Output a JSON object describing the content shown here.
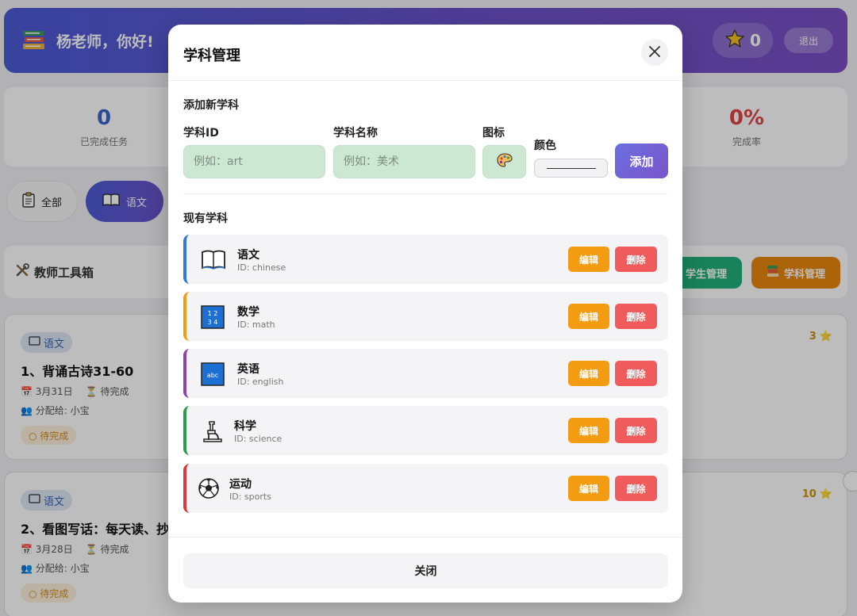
{
  "header": {
    "greeting": "杨老师，你好!",
    "stars": "0",
    "logout_label": "退出"
  },
  "stats": [
    {
      "value": "0",
      "label": "已完成任务",
      "color": "#3b63c9"
    },
    {
      "value": "0%",
      "label": "完成率",
      "color": "#e04646"
    }
  ],
  "filters": {
    "all_label": "全部",
    "chinese_label": "语文"
  },
  "toolbox": {
    "title": "教师工具箱",
    "student_btn": "学生管理",
    "subject_btn": "学科管理"
  },
  "tasks": [
    {
      "tag": "语文",
      "title": "1、背诵古诗31-60",
      "date": "3月31日",
      "state": "待完成",
      "assign": "分配给: 小宝",
      "status": "○ 待完成",
      "points": "3"
    },
    {
      "tag": "语文",
      "title": "2、看图写话：每天读、抄",
      "date": "3月28日",
      "state": "待完成",
      "assign": "分配给: 小宝",
      "status": "○ 待完成",
      "points": "10"
    }
  ],
  "modal": {
    "title": "学科管理",
    "add_section": "添加新学科",
    "id_label": "学科ID",
    "id_placeholder": "例如：art",
    "name_label": "学科名称",
    "name_placeholder": "例如：美术",
    "icon_label": "图标",
    "color_label": "颜色",
    "add_button": "添加",
    "existing_section": "现有学科",
    "edit_label": "编辑",
    "delete_label": "删除",
    "close_button": "关闭",
    "subjects": [
      {
        "name": "语文",
        "id": "ID: chinese",
        "icon": "book-icon",
        "color": "#2f7bd6"
      },
      {
        "name": "数学",
        "id": "ID: math",
        "icon": "numbers-icon",
        "color": "#f39c12"
      },
      {
        "name": "英语",
        "id": "ID: english",
        "icon": "abc-icon",
        "color": "#8e44ad"
      },
      {
        "name": "科学",
        "id": "ID: science",
        "icon": "microscope-icon",
        "color": "#2e9b4e"
      },
      {
        "name": "运动",
        "id": "ID: sports",
        "icon": "soccer-ball-icon",
        "color": "#d63a3a"
      }
    ]
  }
}
